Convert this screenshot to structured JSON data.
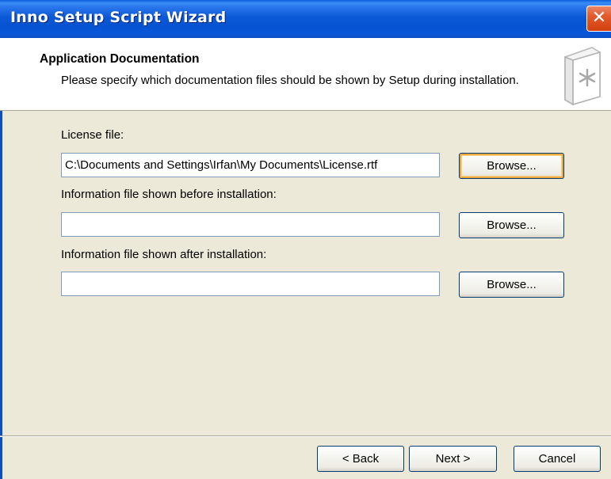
{
  "window": {
    "title": "Inno Setup Script Wizard",
    "close_glyph": "✕",
    "close_icon": "close-icon"
  },
  "header": {
    "title": "Application Documentation",
    "description": "Please specify which documentation files should be shown by Setup during installation.",
    "icon": "document-icon"
  },
  "fields": [
    {
      "label": "License file:",
      "value": "C:\\Documents and Settings\\Irfan\\My Documents\\License.rtf",
      "button_label": "Browse..."
    },
    {
      "label": "Information file shown before installation:",
      "value": "",
      "button_label": "Browse..."
    },
    {
      "label": "Information file shown after installation:",
      "value": "",
      "button_label": "Browse..."
    }
  ],
  "footer": {
    "back_label": "< Back",
    "next_label": "Next >",
    "cancel_label": "Cancel"
  },
  "colors": {
    "titlebar": "#0b57d5",
    "dialog_bg": "#ece9d8",
    "close_button": "#d2410f"
  }
}
